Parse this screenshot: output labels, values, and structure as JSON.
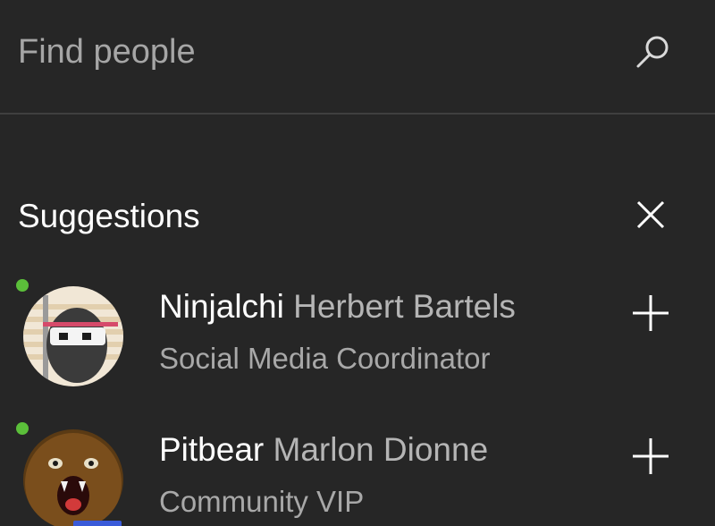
{
  "search": {
    "placeholder": "Find people"
  },
  "suggestions": {
    "title": "Suggestions",
    "items": [
      {
        "gamertag": "Ninjalchi",
        "real_name": "Herbert Bartels",
        "subtitle": "Social Media Coordinator",
        "online": true
      },
      {
        "gamertag": "Pitbear",
        "real_name": "Marlon Dionne",
        "subtitle": "Community VIP",
        "online": true
      }
    ]
  },
  "colors": {
    "background": "#262626",
    "presence_online": "#5bbf3a",
    "secondary_text": "#a8a8a8"
  },
  "icons": {
    "search": "search-icon",
    "close": "close-icon",
    "add": "plus-icon"
  }
}
